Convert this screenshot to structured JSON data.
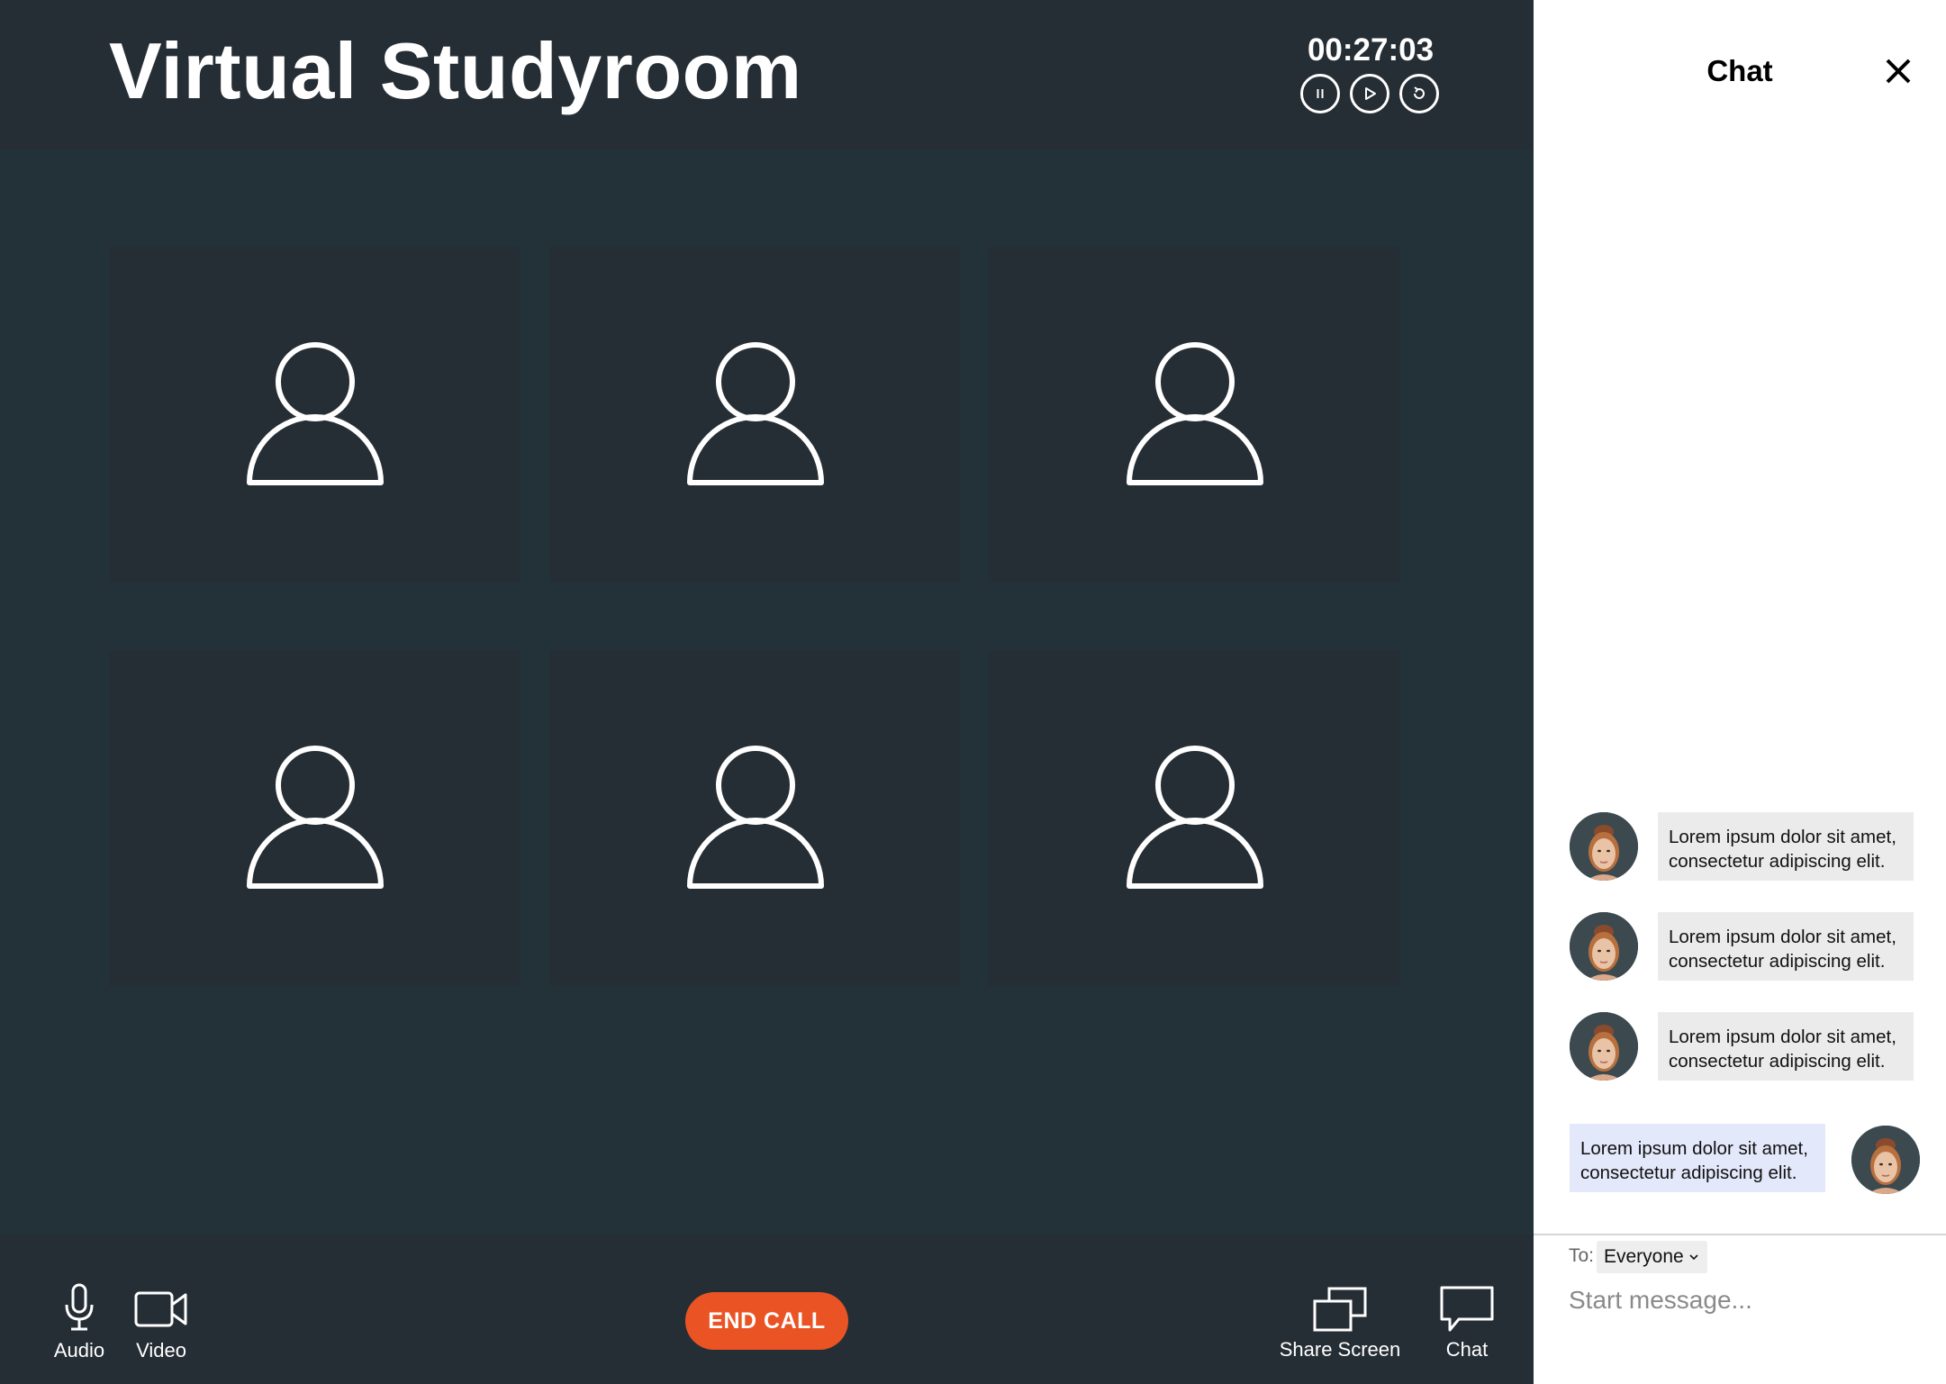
{
  "header": {
    "title": "Virtual Studyroom",
    "timer": "00:27:03"
  },
  "participants": [
    {
      "icon": "person-icon"
    },
    {
      "icon": "person-icon"
    },
    {
      "icon": "person-icon"
    },
    {
      "icon": "person-icon"
    },
    {
      "icon": "person-icon"
    },
    {
      "icon": "person-icon"
    }
  ],
  "toolbar": {
    "audio_label": "Audio",
    "video_label": "Video",
    "end_call_label": "END CALL",
    "share_screen_label": "Share Screen",
    "chat_label": "Chat"
  },
  "chat": {
    "title": "Chat",
    "messages": [
      {
        "text": "Lorem ipsum dolor sit amet, consectetur adipiscing elit.",
        "mine": false
      },
      {
        "text": "Lorem ipsum dolor sit amet, consectetur adipiscing elit.",
        "mine": false
      },
      {
        "text": "Lorem ipsum dolor sit amet, consectetur adipiscing elit.",
        "mine": false
      },
      {
        "text": "Lorem ipsum dolor sit amet, consectetur adipiscing elit.",
        "mine": true
      }
    ],
    "to_label": "To:",
    "recipient": "Everyone",
    "input_placeholder": "Start message..."
  },
  "colors": {
    "accent": "#ea5424",
    "header_bg": "#262e35",
    "stage_bg": "#233139",
    "own_bubble": "#e4e8fb",
    "other_bubble": "#ebebeb"
  }
}
